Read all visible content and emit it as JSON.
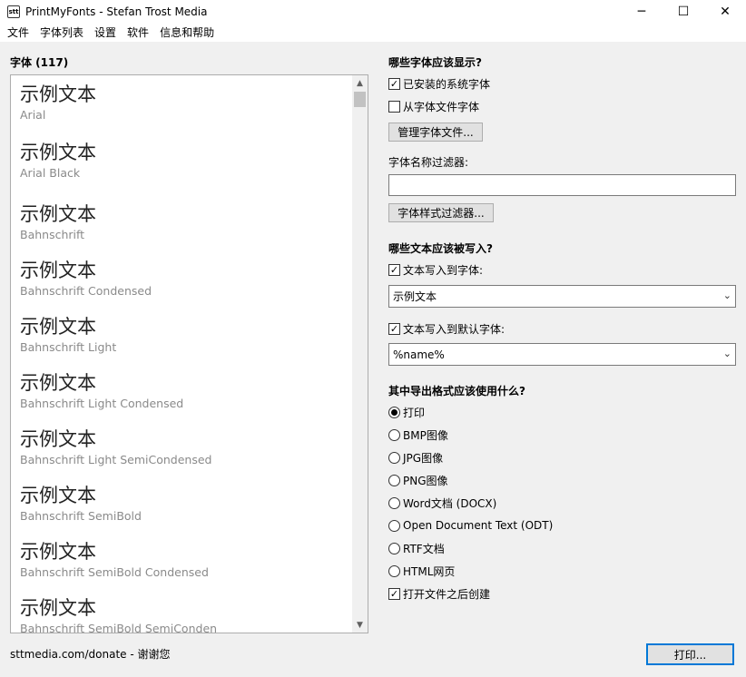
{
  "window": {
    "title": "PrintMyFonts - Stefan Trost Media",
    "icon_text": "stt",
    "minimize": "─",
    "maximize": "☐",
    "close": "✕"
  },
  "menu": [
    "文件",
    "字体列表",
    "设置",
    "软件",
    "信息和帮助"
  ],
  "font_panel": {
    "label": "字体 (117)",
    "fonts": [
      {
        "sample": "示例文本",
        "name": "Arial"
      },
      {
        "sample": "示例文本",
        "name": "Arial Black"
      },
      {
        "sample": "示例文本",
        "name": "Bahnschrift"
      },
      {
        "sample": "示例文本",
        "name": "Bahnschrift Condensed"
      },
      {
        "sample": "示例文本",
        "name": "Bahnschrift Light"
      },
      {
        "sample": "示例文本",
        "name": "Bahnschrift Light Condensed"
      },
      {
        "sample": "示例文本",
        "name": "Bahnschrift Light SemiCondensed"
      },
      {
        "sample": "示例文本",
        "name": "Bahnschrift SemiBold"
      },
      {
        "sample": "示例文本",
        "name": "Bahnschrift SemiBold Condensed"
      },
      {
        "sample": "示例文本",
        "name": "Bahnschrift SemiBold SemiConden"
      }
    ],
    "scroll_up": "▲",
    "scroll_down": "▼"
  },
  "display_section": {
    "title": "哪些字体应该显示?",
    "installed_label": "已安装的系统字体",
    "installed_checked": true,
    "from_file_label": "从字体文件字体",
    "from_file_checked": false,
    "manage_button": "管理字体文件...",
    "filter_label": "字体名称过滤器:",
    "filter_value": "",
    "style_filter_button": "字体样式过滤器..."
  },
  "text_section": {
    "title": "哪些文本应该被写入?",
    "write_font_label": "文本写入到字体:",
    "write_font_checked": true,
    "write_font_value": "示例文本",
    "write_default_label": "文本写入到默认字体:",
    "write_default_checked": true,
    "write_default_value": "%name%"
  },
  "export_section": {
    "title": "其中导出格式应该使用什么?",
    "options": [
      "打印",
      "BMP图像",
      "JPG图像",
      "PNG图像",
      "Word文档 (DOCX)",
      "Open Document Text (ODT)",
      "RTF文档",
      "HTML网页"
    ],
    "selected_index": 0,
    "open_after_label": "打开文件之后创建",
    "open_after_checked": true
  },
  "footer": {
    "donate_text": "sttmedia.com/donate - 谢谢您",
    "print_button": "打印..."
  },
  "icons": {
    "check": "✓",
    "combo_arrow": "⌄"
  }
}
